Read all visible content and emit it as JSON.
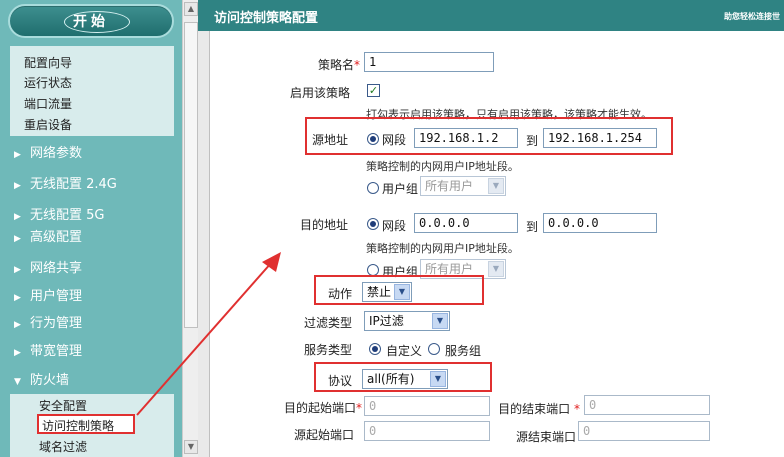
{
  "sidebar": {
    "start_label": "开始",
    "items_top": [
      "配置向导",
      "运行状态",
      "端口流量",
      "重启设备"
    ],
    "sections": [
      "网络参数",
      "无线配置 2.4G",
      "无线配置 5G",
      "高级配置",
      "网络共享",
      "用户管理",
      "行为管理",
      "带宽管理"
    ],
    "firewall": {
      "label": "防火墙",
      "items": [
        "安全配置",
        "访问控制策略",
        "域名过滤"
      ]
    }
  },
  "header": {
    "title": "访问控制策略配置",
    "help": "助您轻松连接世"
  },
  "form": {
    "policy_name_label": "策略名",
    "policy_name_value": "1",
    "enable_label": "启用该策略",
    "enable_hint": "打勾表示启用该策略，只有启用该策略，该策略才能生效。",
    "src_label": "源地址",
    "src_range_label": "网段",
    "src_from": "192.168.1.2",
    "to_label": "到",
    "src_to": "192.168.1.254",
    "src_hint": "策略控制的内网用户IP地址段。",
    "usergroup_label": "用户组",
    "usergroup_value": "所有用户",
    "dst_label": "目的地址",
    "dst_range_label": "网段",
    "dst_from": "0.0.0.0",
    "dst_to": "0.0.0.0",
    "dst_hint": "策略控制的内网用户IP地址段。",
    "dst_usergroup_label": "用户组",
    "dst_usergroup_value": "所有用户",
    "action_label": "动作",
    "action_value": "禁止",
    "filter_label": "过滤类型",
    "filter_value": "IP过滤",
    "service_label": "服务类型",
    "service_custom": "自定义",
    "service_group": "服务组",
    "protocol_label": "协议",
    "protocol_value": "all(所有)",
    "dst_start_port_label": "目的起始端口",
    "dst_start_port": "0",
    "dst_end_port_label": "目的结束端口",
    "dst_end_port": "0",
    "src_start_port_label": "源起始端口",
    "src_start_port": "0",
    "src_end_port_label": "源结束端口",
    "src_end_port": "0"
  },
  "colors": {
    "header": "#2f8383",
    "sidebar": "#6fb9b9",
    "highlight": "#e03030"
  }
}
